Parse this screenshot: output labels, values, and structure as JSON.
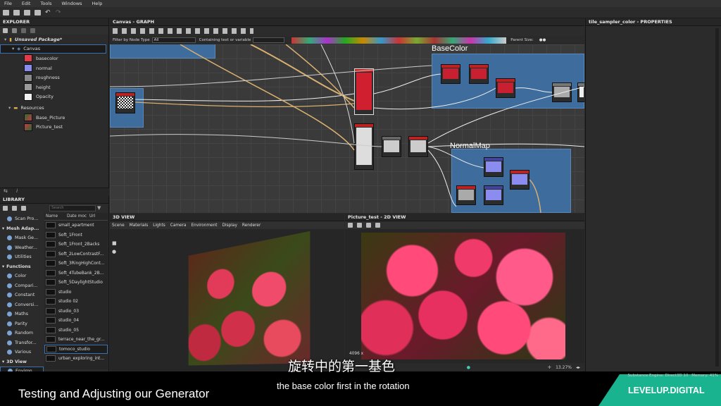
{
  "menu": [
    "File",
    "Edit",
    "Tools",
    "Windows",
    "Help"
  ],
  "explorer": {
    "title": "EXPLORER",
    "package": "Unsaved Package*",
    "graph": "Canvas",
    "outputs": [
      {
        "label": "basecolor",
        "color": "#e23b4a"
      },
      {
        "label": "normal",
        "color": "#8a8cf0"
      },
      {
        "label": "roughness",
        "color": "#8a8a8a"
      },
      {
        "label": "height",
        "color": "#9a9a9a"
      },
      {
        "label": "Opacity",
        "color": "#f2f2f2"
      }
    ],
    "resources_label": "Resources",
    "resources": [
      "Base_Picture",
      "Picture_test"
    ]
  },
  "library": {
    "title": "LIBRARY",
    "search_placeholder": "Search",
    "col_name": "Name",
    "col_date": "Date moc",
    "col_url": "Url",
    "categories": [
      {
        "label": "Scan Pro...",
        "type": "item"
      },
      {
        "label": "Mesh Adap...",
        "type": "section"
      },
      {
        "label": "Mask Ge...",
        "type": "item"
      },
      {
        "label": "Weather...",
        "type": "item"
      },
      {
        "label": "Utilities",
        "type": "item"
      },
      {
        "label": "Functions",
        "type": "section"
      },
      {
        "label": "Color",
        "type": "item"
      },
      {
        "label": "Compari...",
        "type": "item"
      },
      {
        "label": "Constant",
        "type": "item"
      },
      {
        "label": "Conversi...",
        "type": "item"
      },
      {
        "label": "Maths",
        "type": "item"
      },
      {
        "label": "Parity",
        "type": "item"
      },
      {
        "label": "Random",
        "type": "item"
      },
      {
        "label": "Transfor...",
        "type": "item"
      },
      {
        "label": "Various",
        "type": "item"
      },
      {
        "label": "3D View",
        "type": "section"
      },
      {
        "label": "Environ...",
        "type": "item"
      }
    ],
    "assets": [
      "small_apartment",
      "Soft_1Front",
      "Soft_1Front_2Backs",
      "Soft_2LowContrastF...",
      "Soft_3RingHighCont...",
      "Soft_4TubeBank_2B...",
      "Soft_5DaylightStudio",
      "studio",
      "studio 02",
      "studio_03",
      "studio_04",
      "studio_05",
      "terrace_near_the_gr...",
      "tomoco_studio",
      "urban_exploring_int..."
    ]
  },
  "graph": {
    "title": "Canvas - GRAPH",
    "filter_label": "Filter by Node Type",
    "filter_value": "All",
    "containing_label": "Containing text or variable",
    "parent_size_label": "Parent Size:",
    "frames": [
      "BaseColor",
      "NormalMap"
    ]
  },
  "properties": {
    "title": "tile_sampler_color - PROPERTIES"
  },
  "view3d": {
    "title": "3D VIEW",
    "menu": [
      "Scene",
      "Materials",
      "Lights",
      "Camera",
      "Environment",
      "Display",
      "Renderer"
    ]
  },
  "view2d": {
    "title": "Picture_test - 2D VIEW",
    "resolution": "4096 x",
    "zoom": "13.27%"
  },
  "status": {
    "engine": "Substance Engine: Direct3D 10",
    "memory": "Memory: 41%"
  },
  "subtitle": {
    "cn": "旋转中的第一基色",
    "en": "the base color first in the rotation"
  },
  "lower_third": {
    "title": "Testing and Adjusting our Generator",
    "brand": "LEVELUP.DIGITAL"
  }
}
